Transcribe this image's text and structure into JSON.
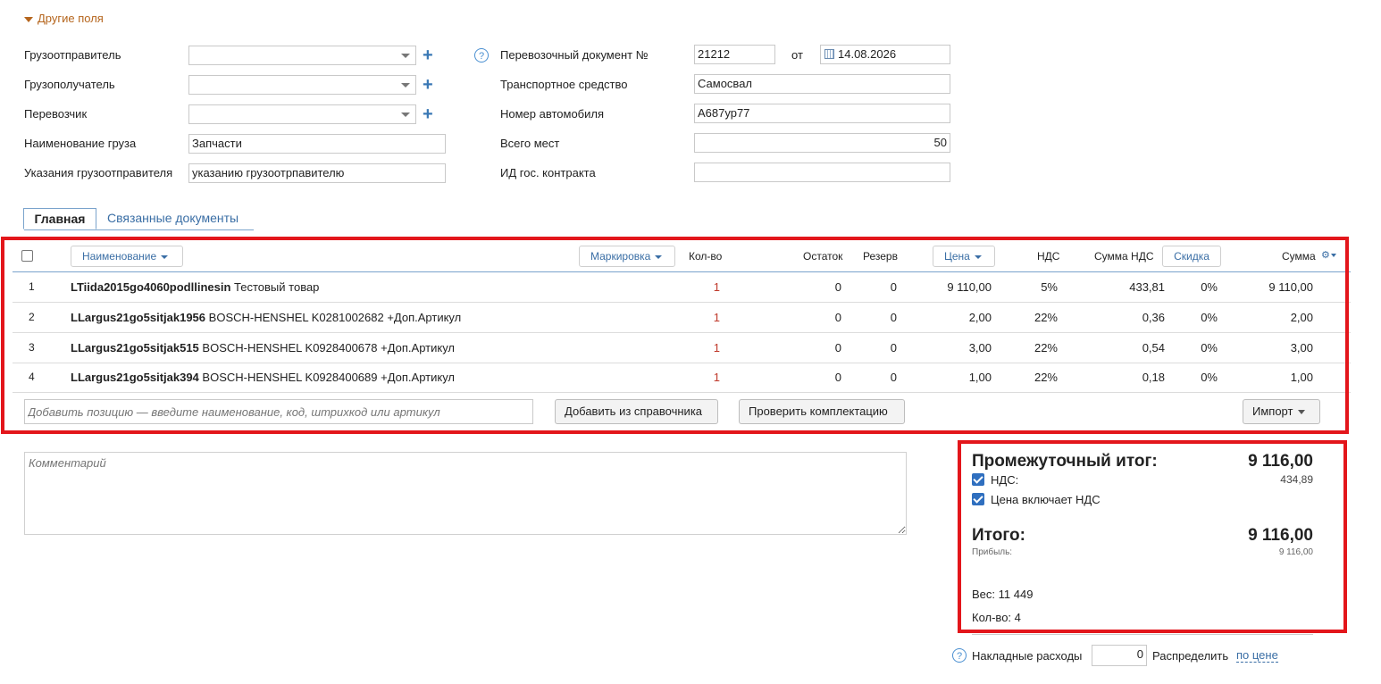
{
  "section_title": "Другие поля",
  "left_fields": [
    {
      "label": "Грузоотправитель",
      "value": ""
    },
    {
      "label": "Грузополучатель",
      "value": ""
    },
    {
      "label": "Перевозчик",
      "value": ""
    },
    {
      "label": "Наименование груза",
      "value": "Запчасти"
    },
    {
      "label": "Указания грузоотправителя",
      "value": "указанию грузоотрпавителю"
    }
  ],
  "right_fields": {
    "doc_label": "Перевозочный документ №",
    "doc_number": "21212",
    "from_label": "от",
    "date": "14.08.2026",
    "vehicle_label": "Транспортное средство",
    "vehicle": "Самосвал",
    "plate_label": "Номер автомобиля",
    "plate": "А687ур77",
    "places_label": "Всего мест",
    "places": "50",
    "contract_label": "ИД гос. контракта",
    "contract": ""
  },
  "tabs": [
    "Главная",
    "Связанные документы"
  ],
  "table": {
    "headers": {
      "name": "Наименование",
      "marking": "Маркировка",
      "qty": "Кол-во",
      "stock": "Остаток",
      "reserve": "Резерв",
      "price": "Цена",
      "vat": "НДС",
      "vat_sum": "Сумма НДС",
      "discount": "Скидка",
      "sum": "Сумма"
    },
    "rows": [
      {
        "n": "1",
        "code": "LTiida2015go4060podllinesin",
        "desc": "Тестовый товар",
        "qty": "1",
        "stock": "0",
        "reserve": "0",
        "price": "9 110,00",
        "vat": "5%",
        "vat_sum": "433,81",
        "discount": "0%",
        "sum": "9 110,00"
      },
      {
        "n": "2",
        "code": "LLargus21go5sitjak1956",
        "desc": "BOSCH-HENSHEL K0281002682 +Доп.Артикул",
        "qty": "1",
        "stock": "0",
        "reserve": "0",
        "price": "2,00",
        "vat": "22%",
        "vat_sum": "0,36",
        "discount": "0%",
        "sum": "2,00"
      },
      {
        "n": "3",
        "code": "LLargus21go5sitjak515",
        "desc": "BOSCH-HENSHEL K0928400678 +Доп.Артикул",
        "qty": "1",
        "stock": "0",
        "reserve": "0",
        "price": "3,00",
        "vat": "22%",
        "vat_sum": "0,54",
        "discount": "0%",
        "sum": "3,00"
      },
      {
        "n": "4",
        "code": "LLargus21go5sitjak394",
        "desc": "BOSCH-HENSHEL K0928400689 +Доп.Артикул",
        "qty": "1",
        "stock": "0",
        "reserve": "0",
        "price": "1,00",
        "vat": "22%",
        "vat_sum": "0,18",
        "discount": "0%",
        "sum": "1,00"
      }
    ],
    "add_placeholder": "Добавить позицию — введите наименование, код, штрихкод или артикул",
    "btn_catalog": "Добавить из справочника",
    "btn_check": "Проверить комплектацию",
    "btn_import": "Импорт"
  },
  "comment_placeholder": "Комментарий",
  "totals": {
    "subtotal_label": "Промежуточный итог:",
    "subtotal": "9 116,00",
    "vat_label": "НДС:",
    "vat": "434,89",
    "price_incl_vat_label": "Цена включает НДС",
    "total_label": "Итого:",
    "total": "9 116,00",
    "profit_label": "Прибыль:",
    "profit": "9 116,00",
    "weight": "Вес: 11 449",
    "count": "Кол-во: 4"
  },
  "overhead": {
    "label": "Накладные расходы",
    "value": "0",
    "distribute_label": "Распределить",
    "distribute_link": "по цене"
  },
  "colors": {
    "accent": "#3a6ea5",
    "highlight": "#e3161b",
    "qty": "#c0392b",
    "section": "#b5651d"
  }
}
